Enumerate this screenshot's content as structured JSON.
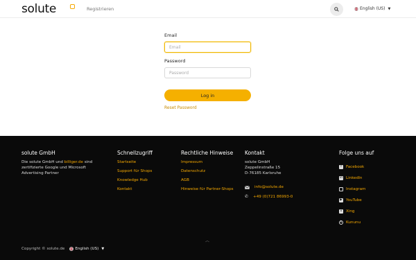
{
  "header": {
    "logo": "solute",
    "register": "Registrieren",
    "language": "English (US)"
  },
  "login": {
    "email_label": "Email",
    "email_placeholder": "Email",
    "password_label": "Password",
    "password_placeholder": "Password",
    "login_button": "Log in",
    "reset_link": "Reset Password"
  },
  "footer": {
    "company": {
      "title": "solute GmbH",
      "desc_1": "Die solute GmbH und ",
      "desc_link": "billiger.de",
      "desc_2": " sind zertifizierte Google und Microsoft Advertising Partner"
    },
    "quick": {
      "title": "Schnellzugriff",
      "links": [
        "Startseite",
        "Support für Shops",
        "Knowledge Hub",
        "Kontakt"
      ]
    },
    "legal": {
      "title": "Rechtliche Hinweise",
      "links": [
        "Impressum",
        "Datenschutz",
        "AGB",
        "Hinweise für Partner-Shops"
      ]
    },
    "contact": {
      "title": "Kontakt",
      "address": [
        "solute GmbH",
        "Zeppelinstraße 15",
        "D-76185 Karlsruhe"
      ],
      "email": "info@solute.de",
      "phone": "+49 (0)721 86993-0"
    },
    "social": {
      "title": "Folge uns auf",
      "items": [
        "Facebook",
        "LinkedIn",
        "Instagram",
        "YouTube",
        "Xing",
        "Kununu"
      ]
    },
    "copyright": "Copyright © solute.de",
    "language": "English (US)"
  },
  "colors": {
    "accent": "#f5b000",
    "footer_bg": "#0a0a0a"
  }
}
